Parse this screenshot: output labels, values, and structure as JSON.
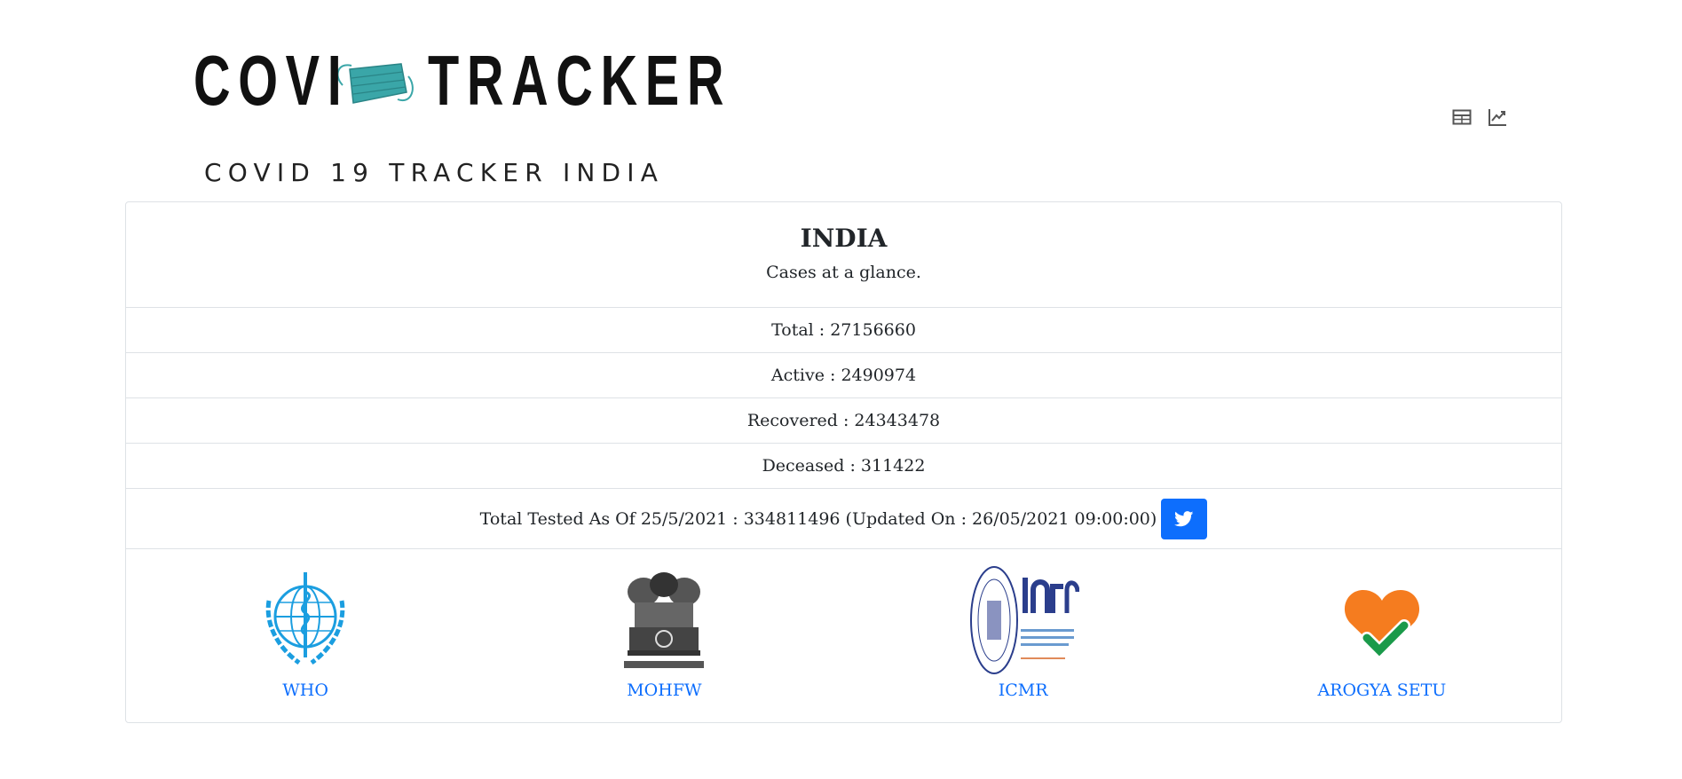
{
  "header": {
    "logo_word_1": "COVI",
    "logo_word_2": "TRACKER",
    "subtitle": "COVID 19 TRACKER INDIA",
    "icons": [
      "table-view-icon",
      "chart-view-icon"
    ]
  },
  "summary": {
    "title": "INDIA",
    "subtitle": "Cases at a glance.",
    "stats": [
      {
        "label": "Total",
        "value": "27156660",
        "text": "Total : 27156660"
      },
      {
        "label": "Active",
        "value": "2490974",
        "text": "Active : 2490974"
      },
      {
        "label": "Recovered",
        "value": "24343478",
        "text": "Recovered : 24343478"
      },
      {
        "label": "Deceased",
        "value": "311422",
        "text": "Deceased : 311422"
      }
    ],
    "tested_text": "Total Tested As Of 25/5/2021 : 334811496 (Updated On : 26/05/2021 09:00:00)",
    "twitter_icon": "twitter-icon"
  },
  "links": [
    {
      "label": "WHO",
      "icon": "who-logo"
    },
    {
      "label": "MOHFW",
      "icon": "national-emblem-logo"
    },
    {
      "label": "ICMR",
      "icon": "icmr-logo"
    },
    {
      "label": "AROGYA SETU",
      "icon": "arogya-setu-logo"
    }
  ],
  "colors": {
    "link": "#0d6efd",
    "twitter_button": "#0d6efd",
    "mask": "#3aa6a8",
    "arogya_heart": "#f57c1f",
    "arogya_check": "#1a9a4a",
    "who_blue": "#1b9ee0"
  }
}
